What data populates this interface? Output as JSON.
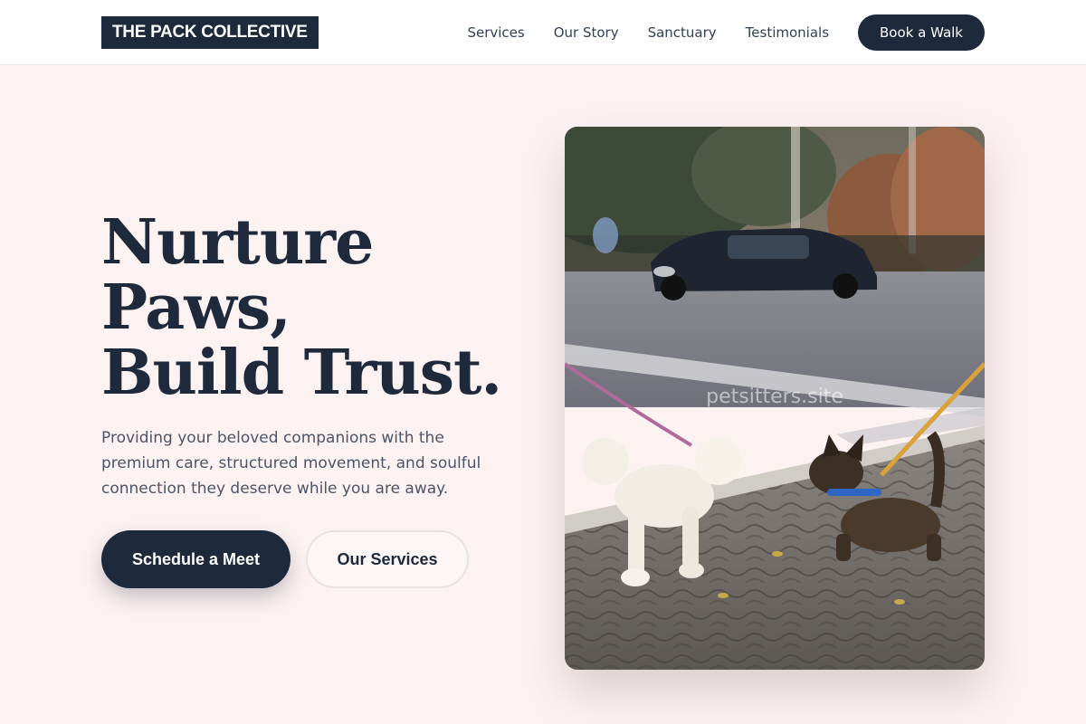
{
  "header": {
    "logo": "THE PACK COLLECTIVE",
    "nav": [
      "Services",
      "Our Story",
      "Sanctuary",
      "Testimonials"
    ],
    "cta_label": "Book a Walk"
  },
  "hero": {
    "title_lines": [
      "Nurture",
      "Paws,",
      "Build Trust."
    ],
    "subtitle": "Providing your beloved companions with the premium care, structured movement, and soulful connection they deserve while you are away.",
    "primary_label": "Schedule a Meet",
    "secondary_label": "Our Services"
  },
  "photo": {
    "watermark": "petsitters.site"
  },
  "colors": {
    "brand_dark": "#1e293b",
    "page_bg": "#fdf2f2",
    "body_text": "#4b5567"
  }
}
